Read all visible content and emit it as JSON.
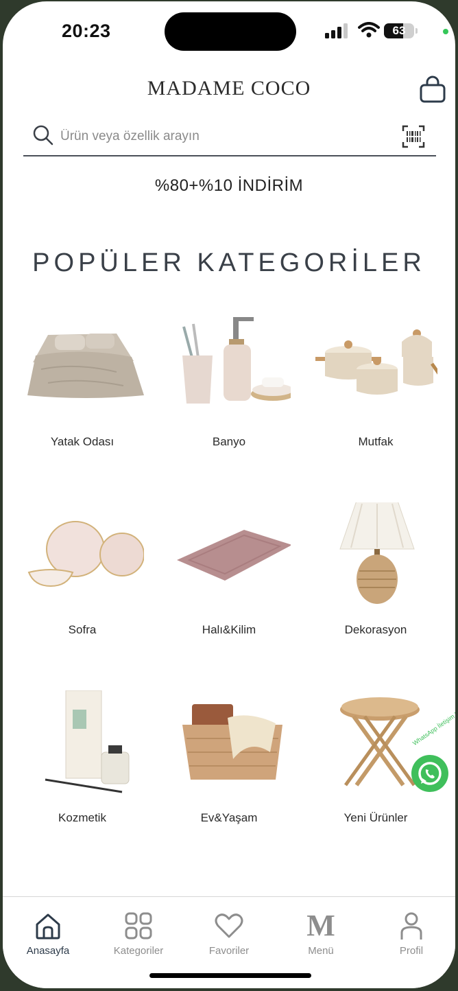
{
  "status_bar": {
    "time": "20:23",
    "battery": "63"
  },
  "header": {
    "brand": "MADAME COCO"
  },
  "search": {
    "placeholder": "Ürün veya özellik arayın"
  },
  "promo": {
    "text": "%80+%10 İNDİRİM"
  },
  "section": {
    "title": "POPÜLER KATEGORİLER"
  },
  "categories": [
    {
      "label": "Yatak Odası",
      "image": "bedding"
    },
    {
      "label": "Banyo",
      "image": "bath-set"
    },
    {
      "label": "Mutfak",
      "image": "cookware"
    },
    {
      "label": "Sofra",
      "image": "plates"
    },
    {
      "label": "Halı&Kilim",
      "image": "rug"
    },
    {
      "label": "Dekorasyon",
      "image": "lamp"
    },
    {
      "label": "Kozmetik",
      "image": "diffuser"
    },
    {
      "label": "Ev&Yaşam",
      "image": "basket"
    },
    {
      "label": "Yeni Ürünler",
      "image": "side-table"
    }
  ],
  "whatsapp": {
    "label": "WhatsApp İletişim Hattı"
  },
  "tabbar": {
    "items": [
      {
        "label": "Anasayfa",
        "icon": "home-icon",
        "active": true
      },
      {
        "label": "Kategoriler",
        "icon": "grid-icon",
        "active": false
      },
      {
        "label": "Favoriler",
        "icon": "heart-icon",
        "active": false
      },
      {
        "label": "Menü",
        "icon": "m-logo-icon",
        "active": false
      },
      {
        "label": "Profil",
        "icon": "user-icon",
        "active": false
      }
    ]
  },
  "colors": {
    "accent": "#2d3b4a",
    "whatsapp": "#3fbf5b",
    "inactive": "#8d8d8d"
  }
}
